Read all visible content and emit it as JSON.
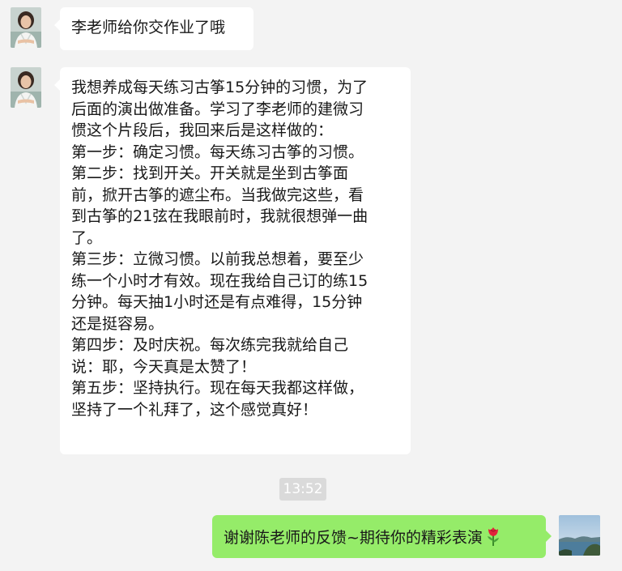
{
  "messages": [
    {
      "sender": "other",
      "lines": [
        "李老师给你交作业了哦"
      ]
    },
    {
      "sender": "other",
      "lines": [
        "我想养成每天练习古筝15分钟的习惯，为了",
        "后面的演出做准备。学习了李老师的建微习",
        "惯这个片段后，我回来后是这样做的：",
        "第一步：确定习惯。每天练习古筝的习惯。",
        "第二步：找到开关。开关就是坐到古筝面",
        "前，掀开古筝的遮尘布。当我做完这些，看",
        "到古筝的21弦在我眼前时，我就很想弹一曲",
        "了。",
        "第三步：立微习惯。以前我总想着，要至少",
        "练一个小时才有效。现在我给自己订的练15",
        "分钟。每天抽1小时还是有点难得，15分钟",
        "还是挺容易。",
        "第四步：及时庆祝。每次练完我就给自己",
        "说：耶，今天真是太赞了！",
        "第五步：坚持执行。现在每天我都这样做，",
        "坚持了一个礼拜了，这个感觉真好！"
      ]
    },
    {
      "sender": "self",
      "text": "谢谢陈老师的反馈~期待你的精彩表演"
    }
  ],
  "timestamp": "13:52",
  "icons": {
    "reply_emoji": "rose-icon",
    "other_avatar": "teacher-avatar",
    "self_avatar": "landscape-avatar"
  },
  "colors": {
    "background": "#f3f3f3",
    "bubble_other": "#ffffff",
    "bubble_self": "#95ec69",
    "timestamp_bg": "#dadada"
  }
}
